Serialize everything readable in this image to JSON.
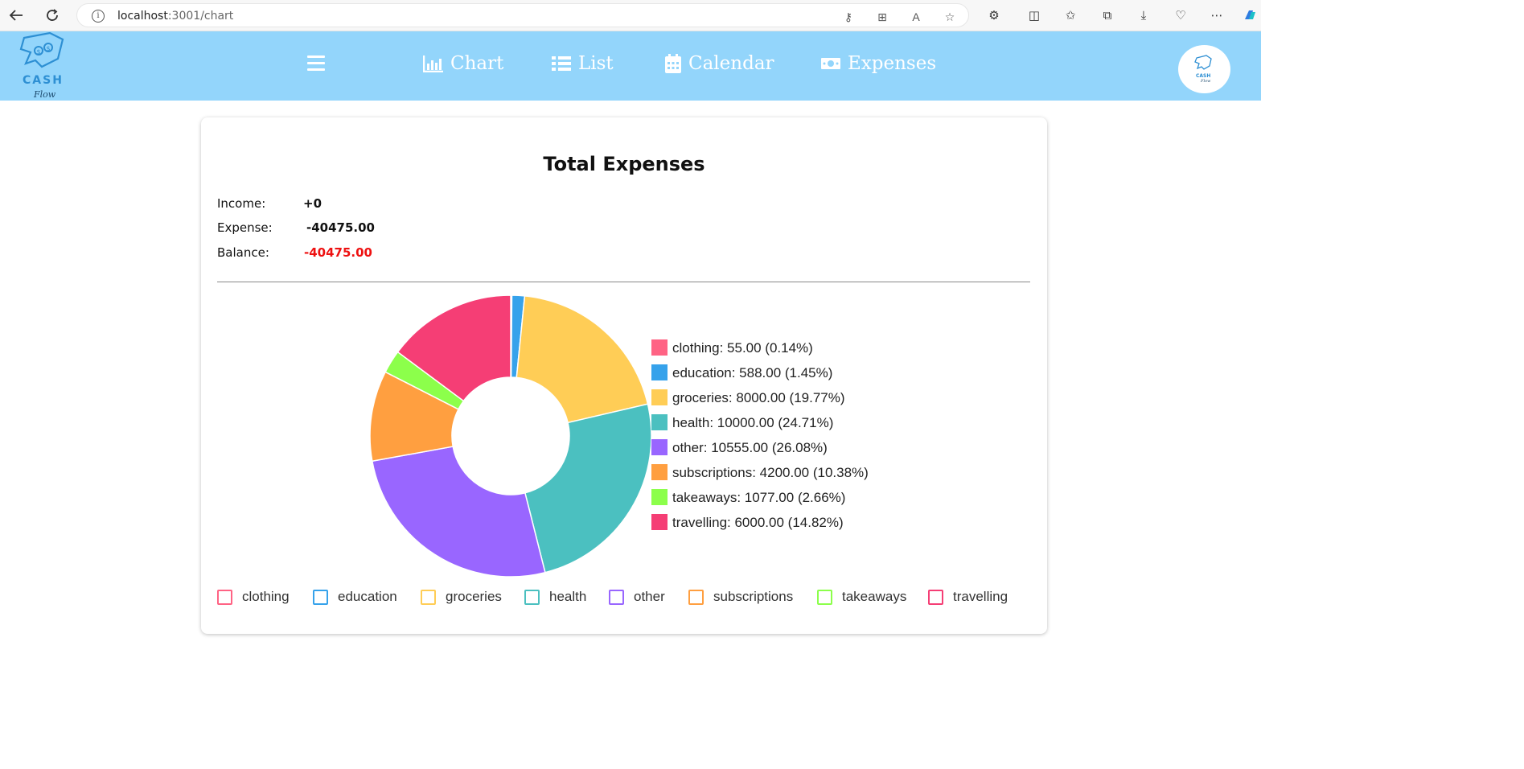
{
  "browser": {
    "url_host": "localhost",
    "url_rest": ":3001/chart"
  },
  "header": {
    "logo_text": "CASH",
    "logo_sub": "Flow",
    "nav": [
      {
        "label": "Chart",
        "icon": "bar-chart-icon"
      },
      {
        "label": "List",
        "icon": "list-icon"
      },
      {
        "label": "Calendar",
        "icon": "calendar-icon"
      },
      {
        "label": "Expenses",
        "icon": "money-icon"
      }
    ]
  },
  "summary": {
    "title": "Total Expenses",
    "income_label": "Income:",
    "income_value": "+0",
    "expense_label": "Expense:",
    "expense_value": "-40475.00",
    "balance_label": "Balance:",
    "balance_value": "-40475.00",
    "balance_color": "#ee1111"
  },
  "chart_data": {
    "type": "pie",
    "donut": true,
    "categories": [
      "clothing",
      "education",
      "groceries",
      "health",
      "other",
      "subscriptions",
      "takeaways",
      "travelling"
    ],
    "values": [
      55,
      588,
      8000,
      10000,
      10555,
      4200,
      1077,
      6000
    ],
    "labels": [
      "clothing: 55.00 (0.14%)",
      "education: 588.00 (1.45%)",
      "groceries: 8000.00 (19.77%)",
      "health: 10000.00 (24.71%)",
      "other: 10555.00 (26.08%)",
      "subscriptions: 4200.00 (10.38%)",
      "takeaways: 1077.00 (2.66%)",
      "travelling: 6000.00 (14.82%)"
    ],
    "colors": [
      "#ff6384",
      "#36a2eb",
      "#ffcd56",
      "#4bc0c0",
      "#9966ff",
      "#ff9f40",
      "#8cff4b",
      "#f53e75"
    ],
    "legend_position": "bottom"
  }
}
